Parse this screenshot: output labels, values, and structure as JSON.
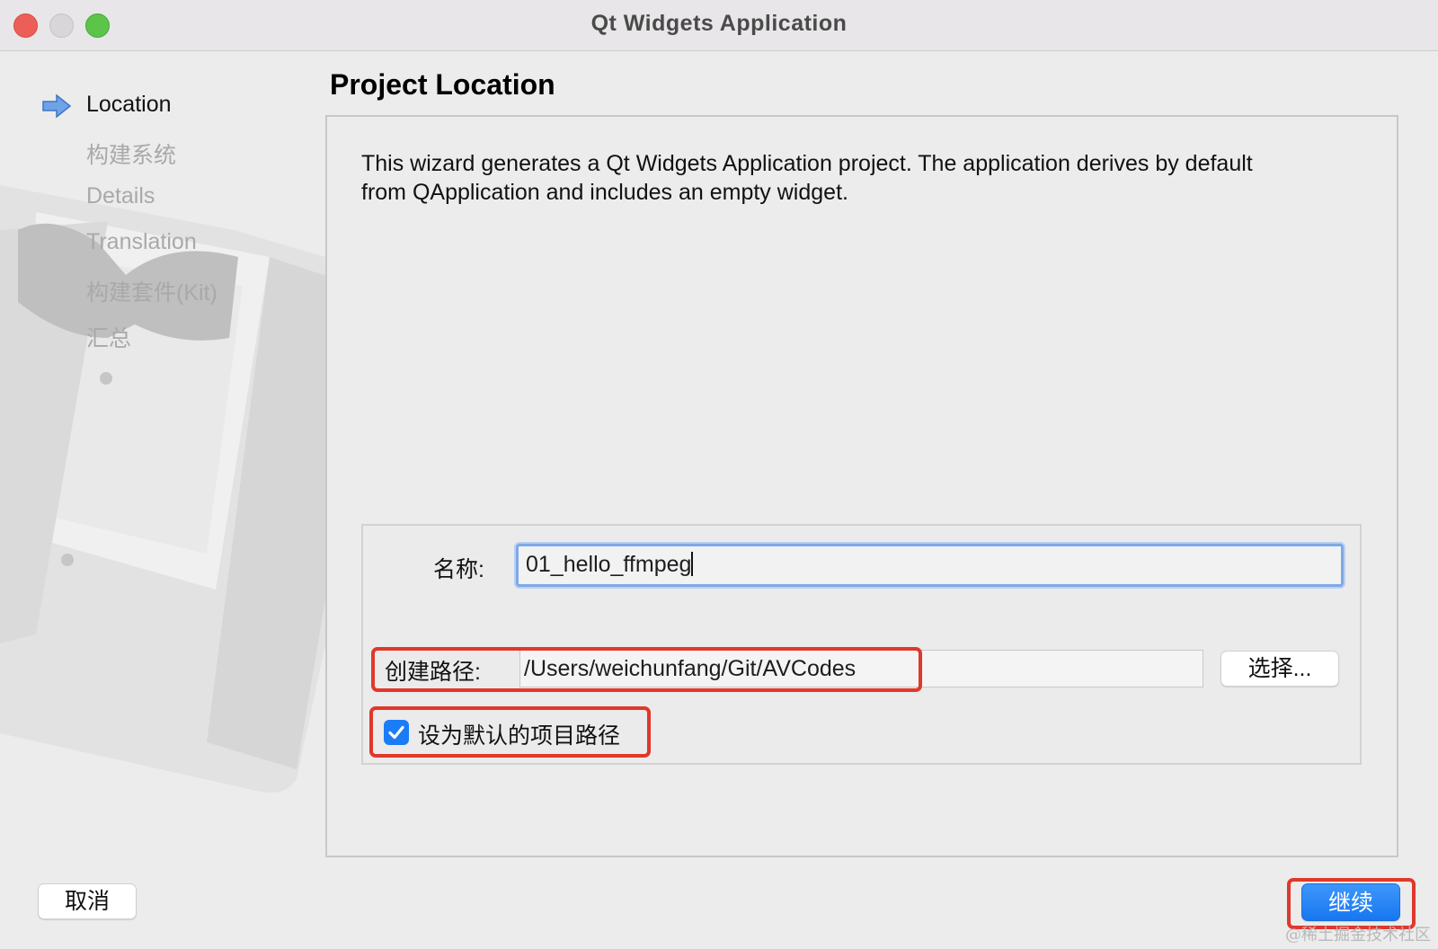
{
  "window": {
    "title": "Qt Widgets Application",
    "controls": [
      "close",
      "minimize",
      "maximize"
    ]
  },
  "sidebar": {
    "steps": [
      {
        "label": "Location",
        "state": "current"
      },
      {
        "label": "构建系统",
        "state": "pending"
      },
      {
        "label": "Details",
        "state": "pending"
      },
      {
        "label": "Translation",
        "state": "pending"
      },
      {
        "label": "构建套件(Kit)",
        "state": "pending"
      },
      {
        "label": "汇总",
        "state": "pending"
      }
    ],
    "current_icon": "arrow-right-icon"
  },
  "page": {
    "title": "Project Location",
    "description_line1": "This wizard generates a Qt Widgets Application project. The application derives by default",
    "description_line2": "from QApplication and includes an empty widget."
  },
  "form": {
    "name_label": "名称:",
    "name_value": "01_hello_ffmpeg",
    "path_label": "创建路径:",
    "path_value": "/Users/weichunfang/Git/AVCodes",
    "browse_label": "选择...",
    "default_checkbox_label": "设为默认的项目路径",
    "default_checkbox_checked": true
  },
  "footer": {
    "cancel_label": "取消",
    "continue_label": "继续"
  },
  "watermark": "@稀土掘金技术社区",
  "colors": {
    "accent": "#1a7cf6",
    "highlight": "#e0382b",
    "focus_ring": "#7fa9e6"
  }
}
